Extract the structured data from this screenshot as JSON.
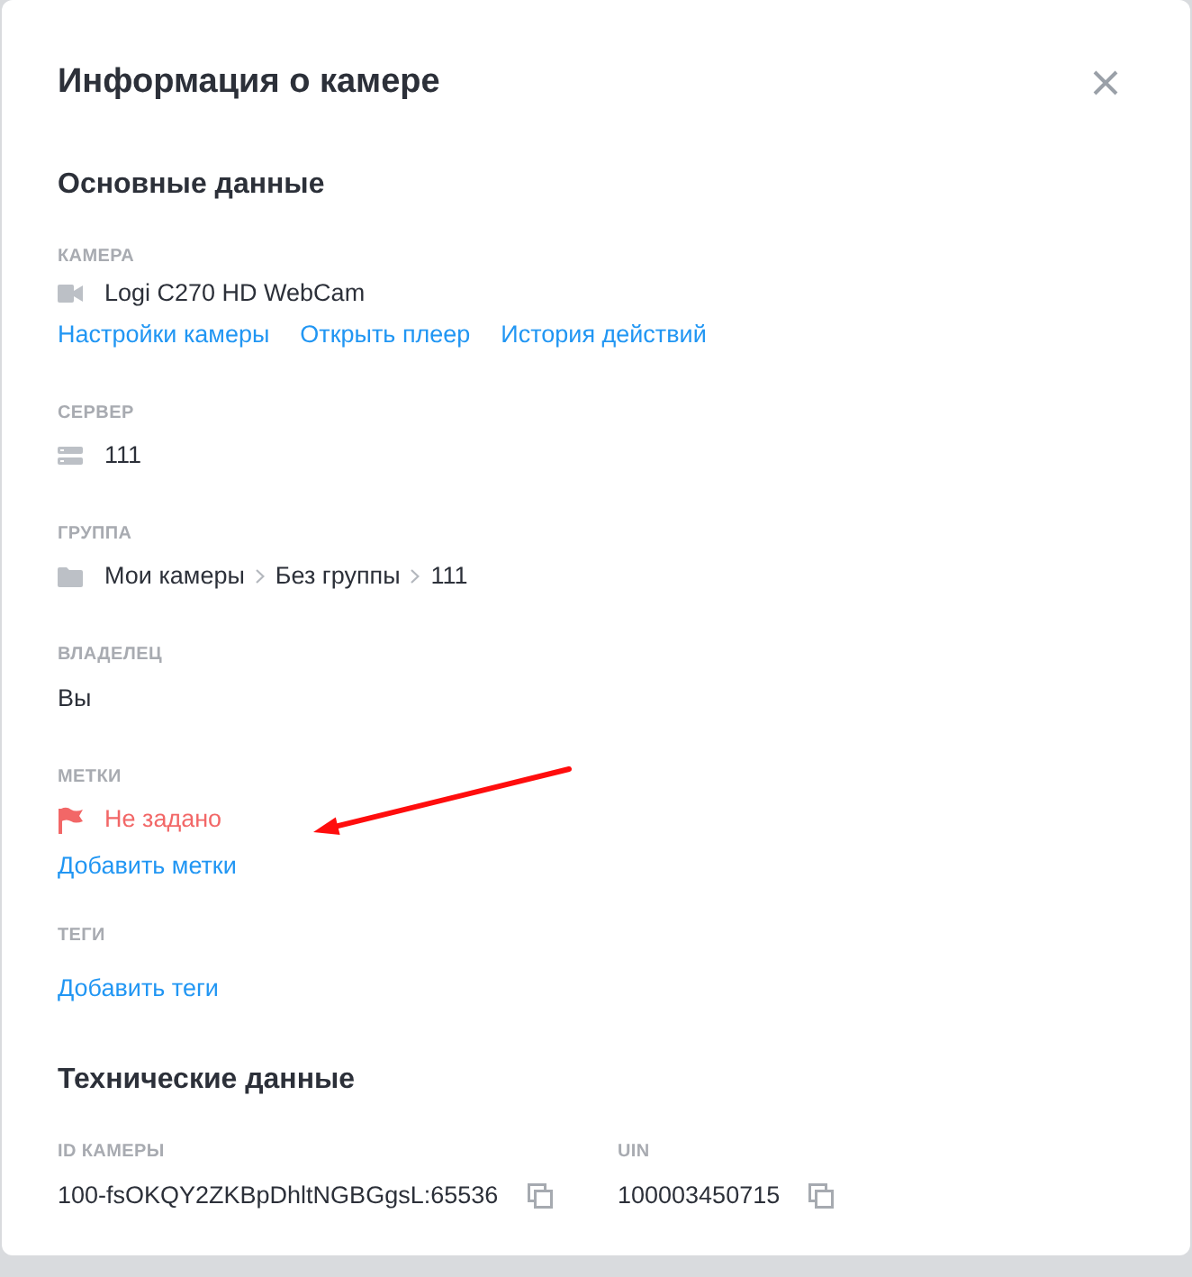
{
  "dialog": {
    "title": "Информация о камере"
  },
  "sections": [
    {
      "kind": "stack",
      "heading": "Основные данные",
      "fields": [
        {
          "kind": "camera",
          "label": "КАМЕРА",
          "value": "Logi C270 HD WebCam",
          "links": [
            "Настройки камеры",
            "Открыть плеер",
            "История действий"
          ]
        },
        {
          "kind": "server",
          "label": "СЕРВЕР",
          "value": "111"
        },
        {
          "kind": "group",
          "label": "ГРУППА",
          "path": [
            "Мои камеры",
            "Без группы",
            "111"
          ]
        },
        {
          "kind": "owner",
          "label": "ВЛАДЕЛЕЦ",
          "value": "Вы"
        },
        {
          "kind": "marks",
          "label": "МЕТКИ",
          "empty_text": "Не задано",
          "links": [
            "Добавить метки"
          ]
        },
        {
          "kind": "tags",
          "label": "ТЕГИ",
          "links": [
            "Добавить теги"
          ]
        }
      ]
    },
    {
      "kind": "columns",
      "heading": "Технические данные",
      "fields": [
        {
          "kind": "copyable",
          "label": "ID КАМЕРЫ",
          "value": "100-fsOKQY2ZKBpDhltNGBGgsL:65536"
        },
        {
          "kind": "copyable",
          "label": "UIN",
          "value": "100003450715"
        }
      ]
    }
  ],
  "annotations": [
    {
      "kind": "arrow"
    }
  ]
}
